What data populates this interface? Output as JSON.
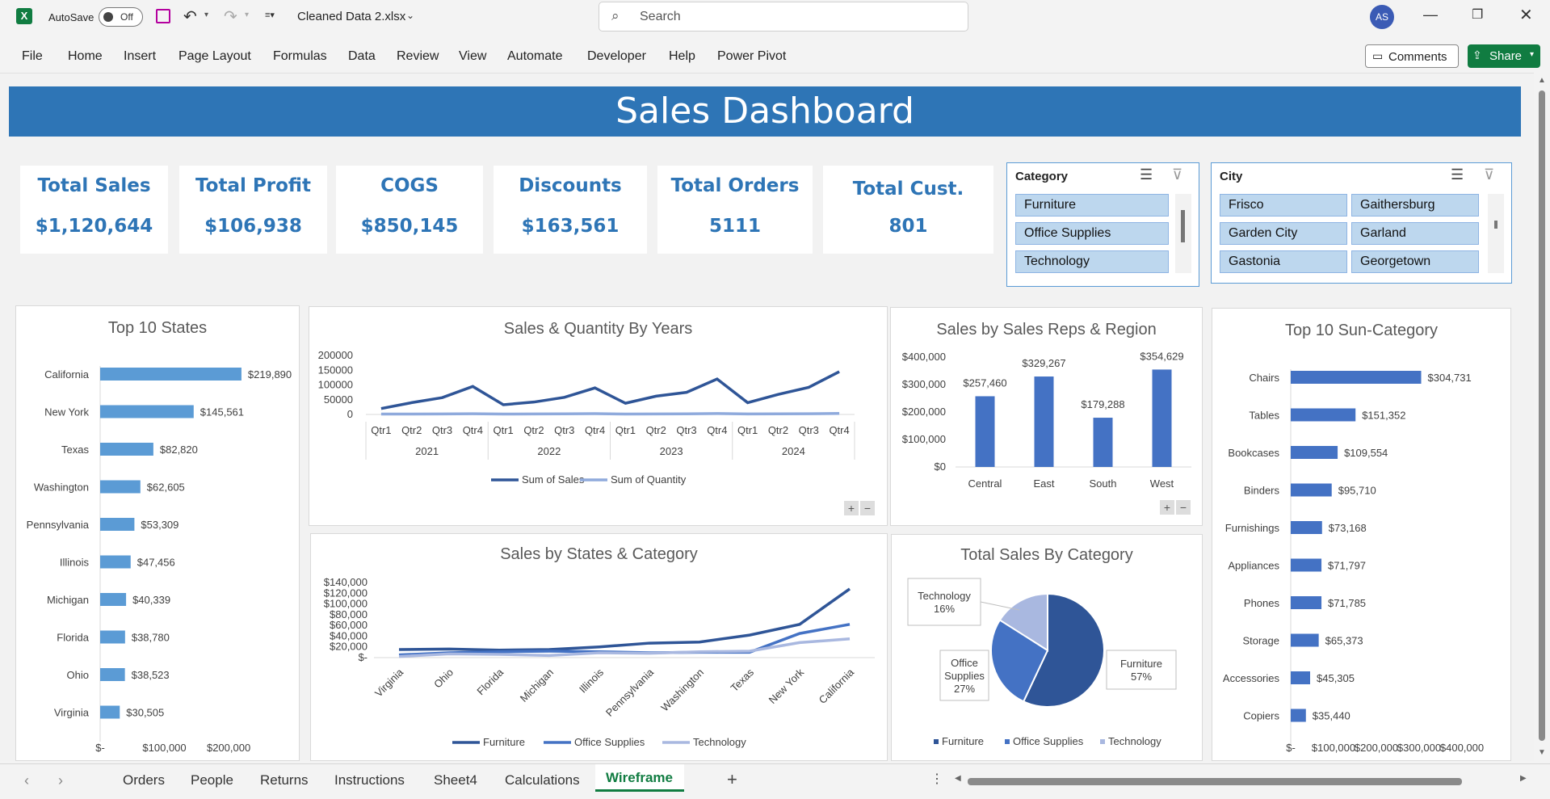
{
  "app": {
    "autosave_label": "AutoSave",
    "autosave_state": "Off",
    "filename": "Cleaned Data 2.xlsx",
    "search_placeholder": "Search",
    "user_initials": "AS",
    "comments_label": "Comments",
    "share_label": "Share"
  },
  "menu": [
    "File",
    "Home",
    "Insert",
    "Page Layout",
    "Formulas",
    "Data",
    "Review",
    "View",
    "Automate",
    "Developer",
    "Help",
    "Power Pivot"
  ],
  "banner_title": "Sales Dashboard",
  "kpis": [
    {
      "title": "Total Sales",
      "value": "$1,120,644"
    },
    {
      "title": "Total Profit",
      "value": "$106,938"
    },
    {
      "title": "COGS",
      "value": "$850,145"
    },
    {
      "title": "Discounts",
      "value": "$163,561"
    },
    {
      "title": "Total Orders",
      "value": "5111"
    },
    {
      "title": "Total Cust.",
      "value": "801"
    }
  ],
  "slicers": {
    "category": {
      "title": "Category",
      "items": [
        "Furniture",
        "Office Supplies",
        "Technology"
      ]
    },
    "city": {
      "title": "City",
      "items": [
        "Frisco",
        "Gaithersburg",
        "Garden City",
        "Garland",
        "Gastonia",
        "Georgetown"
      ]
    }
  },
  "chart_data": [
    {
      "type": "bar",
      "title": "Top 10 States",
      "categories": [
        "California",
        "New York",
        "Texas",
        "Washington",
        "Pennsylvania",
        "Illinois",
        "Michigan",
        "Florida",
        "Ohio",
        "Virginia"
      ],
      "values": [
        219890,
        145561,
        82820,
        62605,
        53309,
        47456,
        40339,
        38780,
        38523,
        30505
      ],
      "data_labels": [
        "$219,890",
        "$145,561",
        "$82,820",
        "$62,605",
        "$53,309",
        "$47,456",
        "$40,339",
        "$38,780",
        "$38,523",
        "$30,505"
      ],
      "x_ticks": [
        "$-",
        "$100,000",
        "$200,000"
      ],
      "xlim": [
        0,
        220000
      ],
      "color": "#5b9bd5"
    },
    {
      "type": "line",
      "title": "Sales & Quantity By Years",
      "quarters": [
        "Qtr1",
        "Qtr2",
        "Qtr3",
        "Qtr4",
        "Qtr1",
        "Qtr2",
        "Qtr3",
        "Qtr4",
        "Qtr1",
        "Qtr2",
        "Qtr3",
        "Qtr4",
        "Qtr1",
        "Qtr2",
        "Qtr3",
        "Qtr4"
      ],
      "years": [
        "2021",
        "2022",
        "2023",
        "2024"
      ],
      "y_ticks": [
        "200000",
        "150000",
        "100000",
        "50000",
        "0"
      ],
      "ylim": [
        0,
        200000
      ],
      "series": [
        {
          "name": "Sum of Sales",
          "color": "#2f5597",
          "values": [
            20000,
            40000,
            57000,
            95000,
            33000,
            42000,
            58000,
            90000,
            38000,
            62000,
            75000,
            120000,
            40000,
            68000,
            92000,
            145000
          ]
        },
        {
          "name": "Sum of Quantity",
          "color": "#8faadc",
          "values": [
            1200,
            1500,
            1800,
            2500,
            1300,
            1600,
            1900,
            2600,
            1500,
            1800,
            2100,
            3000,
            1600,
            2100,
            2500,
            3400
          ]
        }
      ]
    },
    {
      "type": "bar",
      "title": "Sales by Sales Reps & Region",
      "categories": [
        "Central",
        "East",
        "South",
        "West"
      ],
      "values": [
        257460,
        329267,
        179288,
        354629
      ],
      "data_labels": [
        "$257,460",
        "$329,267",
        "$179,288",
        "$354,629"
      ],
      "y_ticks": [
        "$400,000",
        "$300,000",
        "$200,000",
        "$100,000",
        "$0"
      ],
      "ylim": [
        0,
        400000
      ],
      "color": "#4472c4"
    },
    {
      "type": "bar",
      "title": "Top 10 Sun-Category",
      "categories": [
        "Chairs",
        "Tables",
        "Bookcases",
        "Binders",
        "Furnishings",
        "Appliances",
        "Phones",
        "Storage",
        "Accessories",
        "Copiers"
      ],
      "values": [
        304731,
        151352,
        109554,
        95710,
        73168,
        71797,
        71785,
        65373,
        45305,
        35440
      ],
      "data_labels": [
        "$304,731",
        "$151,352",
        "$109,554",
        "$95,710",
        "$73,168",
        "$71,797",
        "$71,785",
        "$65,373",
        "$45,305",
        "$35,440"
      ],
      "x_ticks": [
        "$-",
        "$100,000",
        "$200,000",
        "$300,000",
        "$400,000"
      ],
      "xlim": [
        0,
        400000
      ],
      "color": "#4472c4"
    },
    {
      "type": "line",
      "title": "Sales by States & Category",
      "categories": [
        "Virginia",
        "Ohio",
        "Florida",
        "Michigan",
        "Illinois",
        "Pennsylvania",
        "Washington",
        "Texas",
        "New York",
        "California"
      ],
      "y_ticks": [
        "$140,000",
        "$120,000",
        "$100,000",
        "$80,000",
        "$60,000",
        "$40,000",
        "$20,000",
        "$-"
      ],
      "ylim": [
        0,
        140000
      ],
      "series": [
        {
          "name": "Furniture",
          "color": "#2f5597",
          "values": [
            15000,
            16000,
            14000,
            15000,
            20000,
            27000,
            29000,
            42000,
            62000,
            128000
          ]
        },
        {
          "name": "Office Supplies",
          "color": "#4472c4",
          "values": [
            5000,
            9000,
            11000,
            12000,
            11000,
            9000,
            10000,
            10000,
            45000,
            62000
          ]
        },
        {
          "name": "Technology",
          "color": "#a9b8e0",
          "values": [
            2000,
            7000,
            6000,
            4000,
            9000,
            8000,
            11000,
            12000,
            28000,
            35000
          ]
        }
      ]
    },
    {
      "type": "pie",
      "title": "Total Sales By Category",
      "categories": [
        "Furniture",
        "Office Supplies",
        "Technology"
      ],
      "values": [
        57,
        27,
        16
      ],
      "labels": [
        "Furniture\n57%",
        "Office\nSupplies\n27%",
        "Technology\n16%"
      ],
      "colors": [
        "#2f5597",
        "#4472c4",
        "#a9b8e0"
      ]
    }
  ],
  "legends": {
    "sales_qty": [
      "Sum of Sales",
      "Sum of Quantity"
    ],
    "states_cat": [
      "Furniture",
      "Office Supplies",
      "Technology"
    ],
    "pie": [
      "Furniture",
      "Office Supplies",
      "Technology"
    ]
  },
  "sheet_tabs": [
    "Orders",
    "People",
    "Returns",
    "Instructions",
    "Sheet4",
    "Calculations",
    "Wireframe"
  ],
  "active_tab": "Wireframe"
}
